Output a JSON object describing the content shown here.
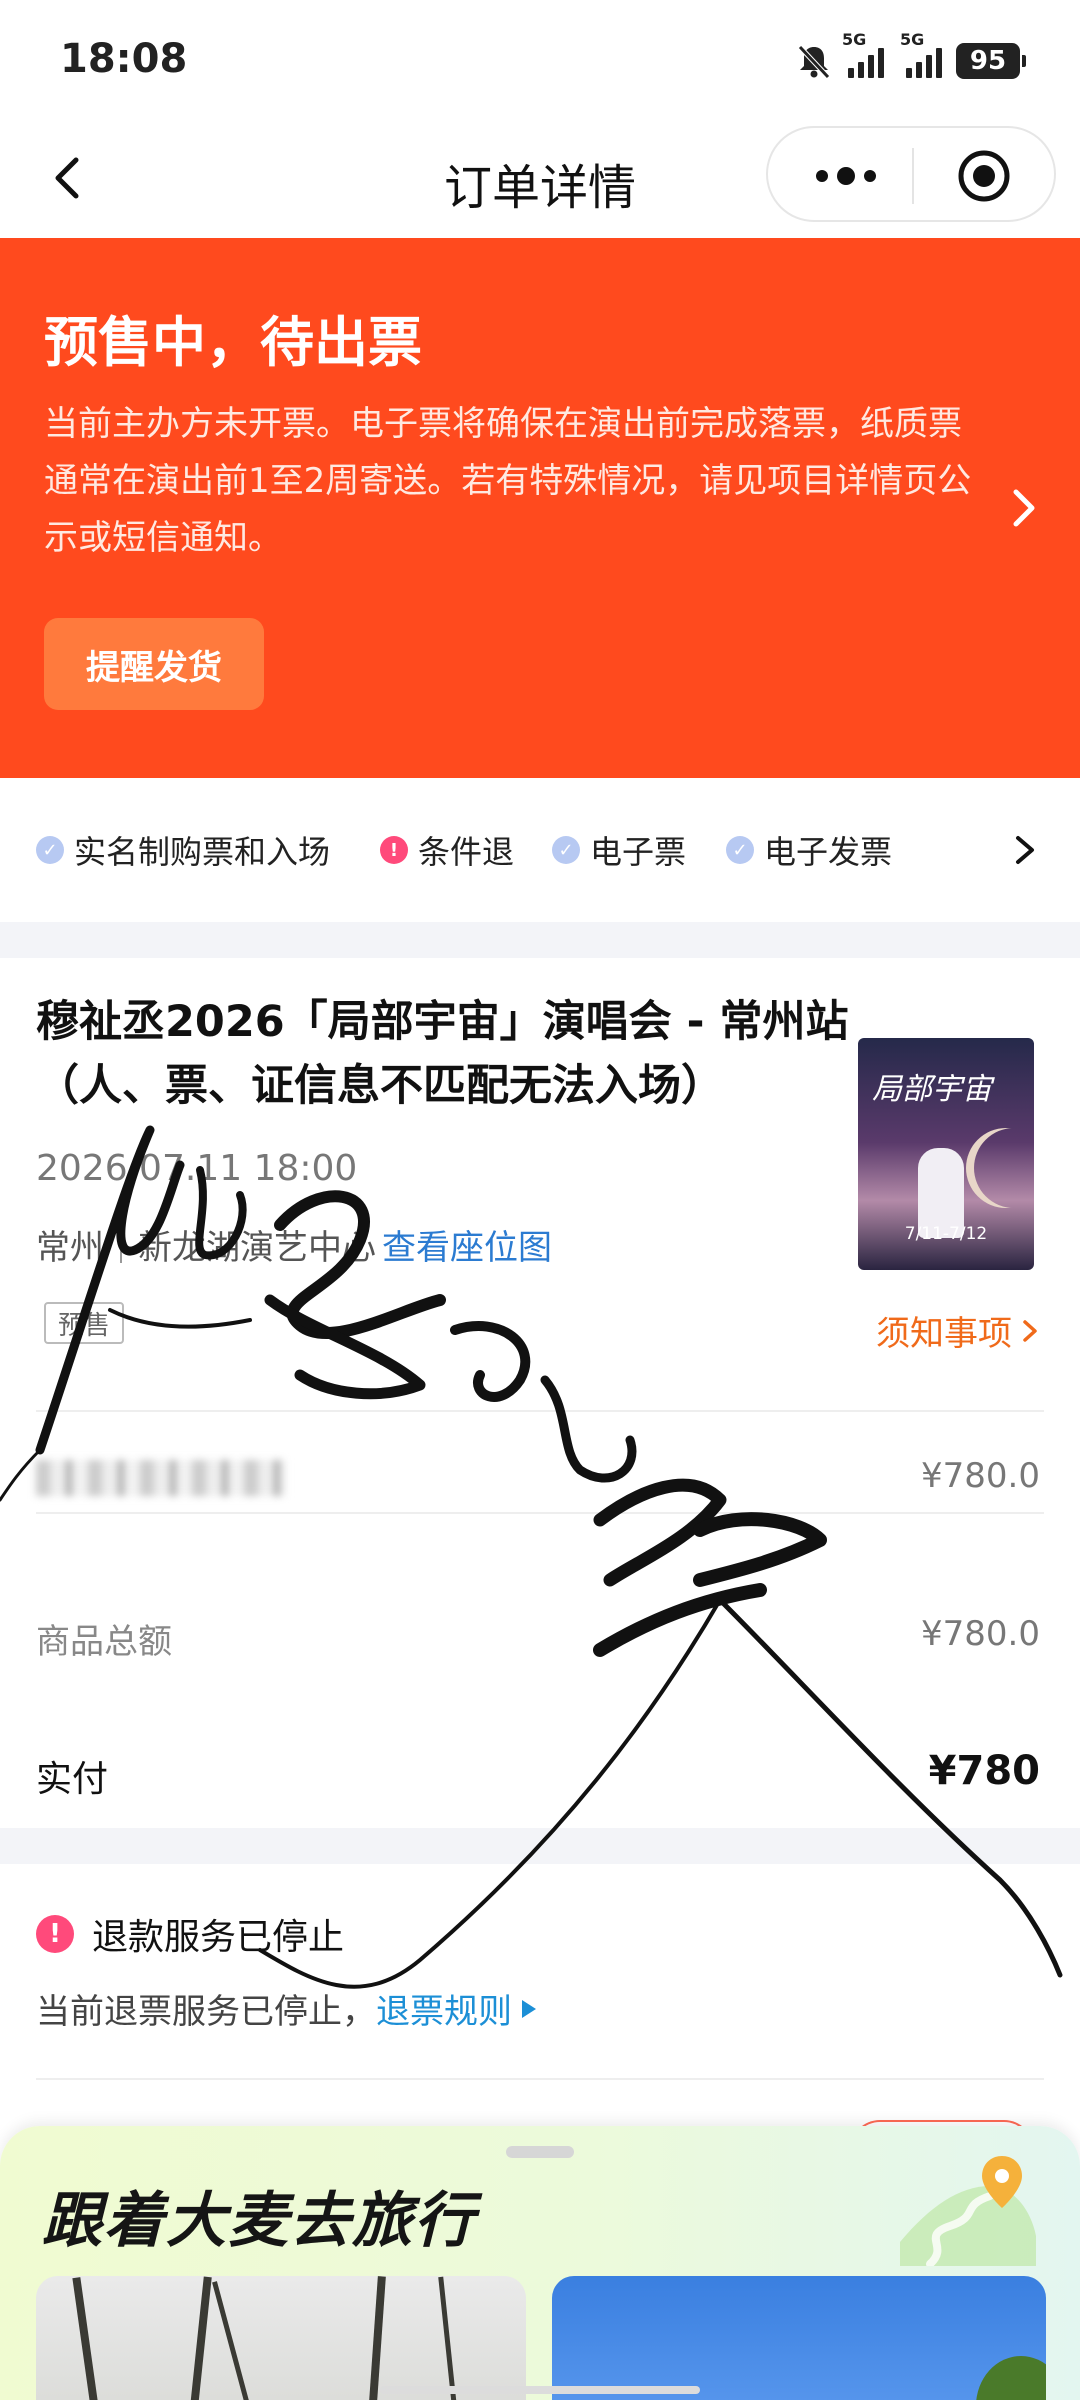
{
  "status_bar": {
    "time": "18:08",
    "sim1_label": "5G",
    "sim2_label": "5G",
    "battery": "95",
    "icons": [
      "bell-muted-icon",
      "signal-icon",
      "signal-icon",
      "battery-icon"
    ]
  },
  "nav": {
    "title": "订单详情",
    "icons": [
      "back-chevron-icon",
      "more-dots-icon",
      "target-icon"
    ]
  },
  "banner": {
    "title": "预售中，待出票",
    "description": "当前主办方未开票。电子票将确保在演出前完成落票，纸质票通常在演出前1至2周寄送。若有特殊情况，请见项目详情页公示或短信通知。",
    "remind_button": "提醒发货",
    "background_color": "#ff4a1e"
  },
  "tags": [
    {
      "label": "实名制购票和入场",
      "icon": "check-circle-icon"
    },
    {
      "label": "条件退",
      "icon": "alert-circle-icon"
    },
    {
      "label": "电子票",
      "icon": "check-circle-icon"
    },
    {
      "label": "电子发票",
      "icon": "check-circle-icon"
    }
  ],
  "event": {
    "title": "穆祉丞2026「局部宇宙」演唱会 - 常州站（人、票、证信息不匹配无法入场）",
    "datetime": "2026.07.11 18:00",
    "city": "常州",
    "venue": "新龙湖演艺中心",
    "seat_map_link": "查看座位图",
    "badge": "预售",
    "notice_link": "须知事项",
    "poster": {
      "title": "局部宇宙",
      "dates": "7/11-7/12"
    }
  },
  "price_rows": {
    "ticket_price": "¥780.0",
    "subtotal_label": "商品总额",
    "subtotal_value": "¥780.0",
    "paid_label": "实付",
    "paid_value": "¥780"
  },
  "refund": {
    "heading": "退款服务已停止",
    "description": "当前退票服务已停止，",
    "rules_link": "退票规则"
  },
  "travel_sheet": {
    "title": "跟着大麦去旅行",
    "icons": [
      "map-pin-icon"
    ]
  },
  "colors": {
    "accent_orange": "#f06a1a",
    "link_blue": "#2b7bd1",
    "warn_pink": "#ff4a7b"
  }
}
